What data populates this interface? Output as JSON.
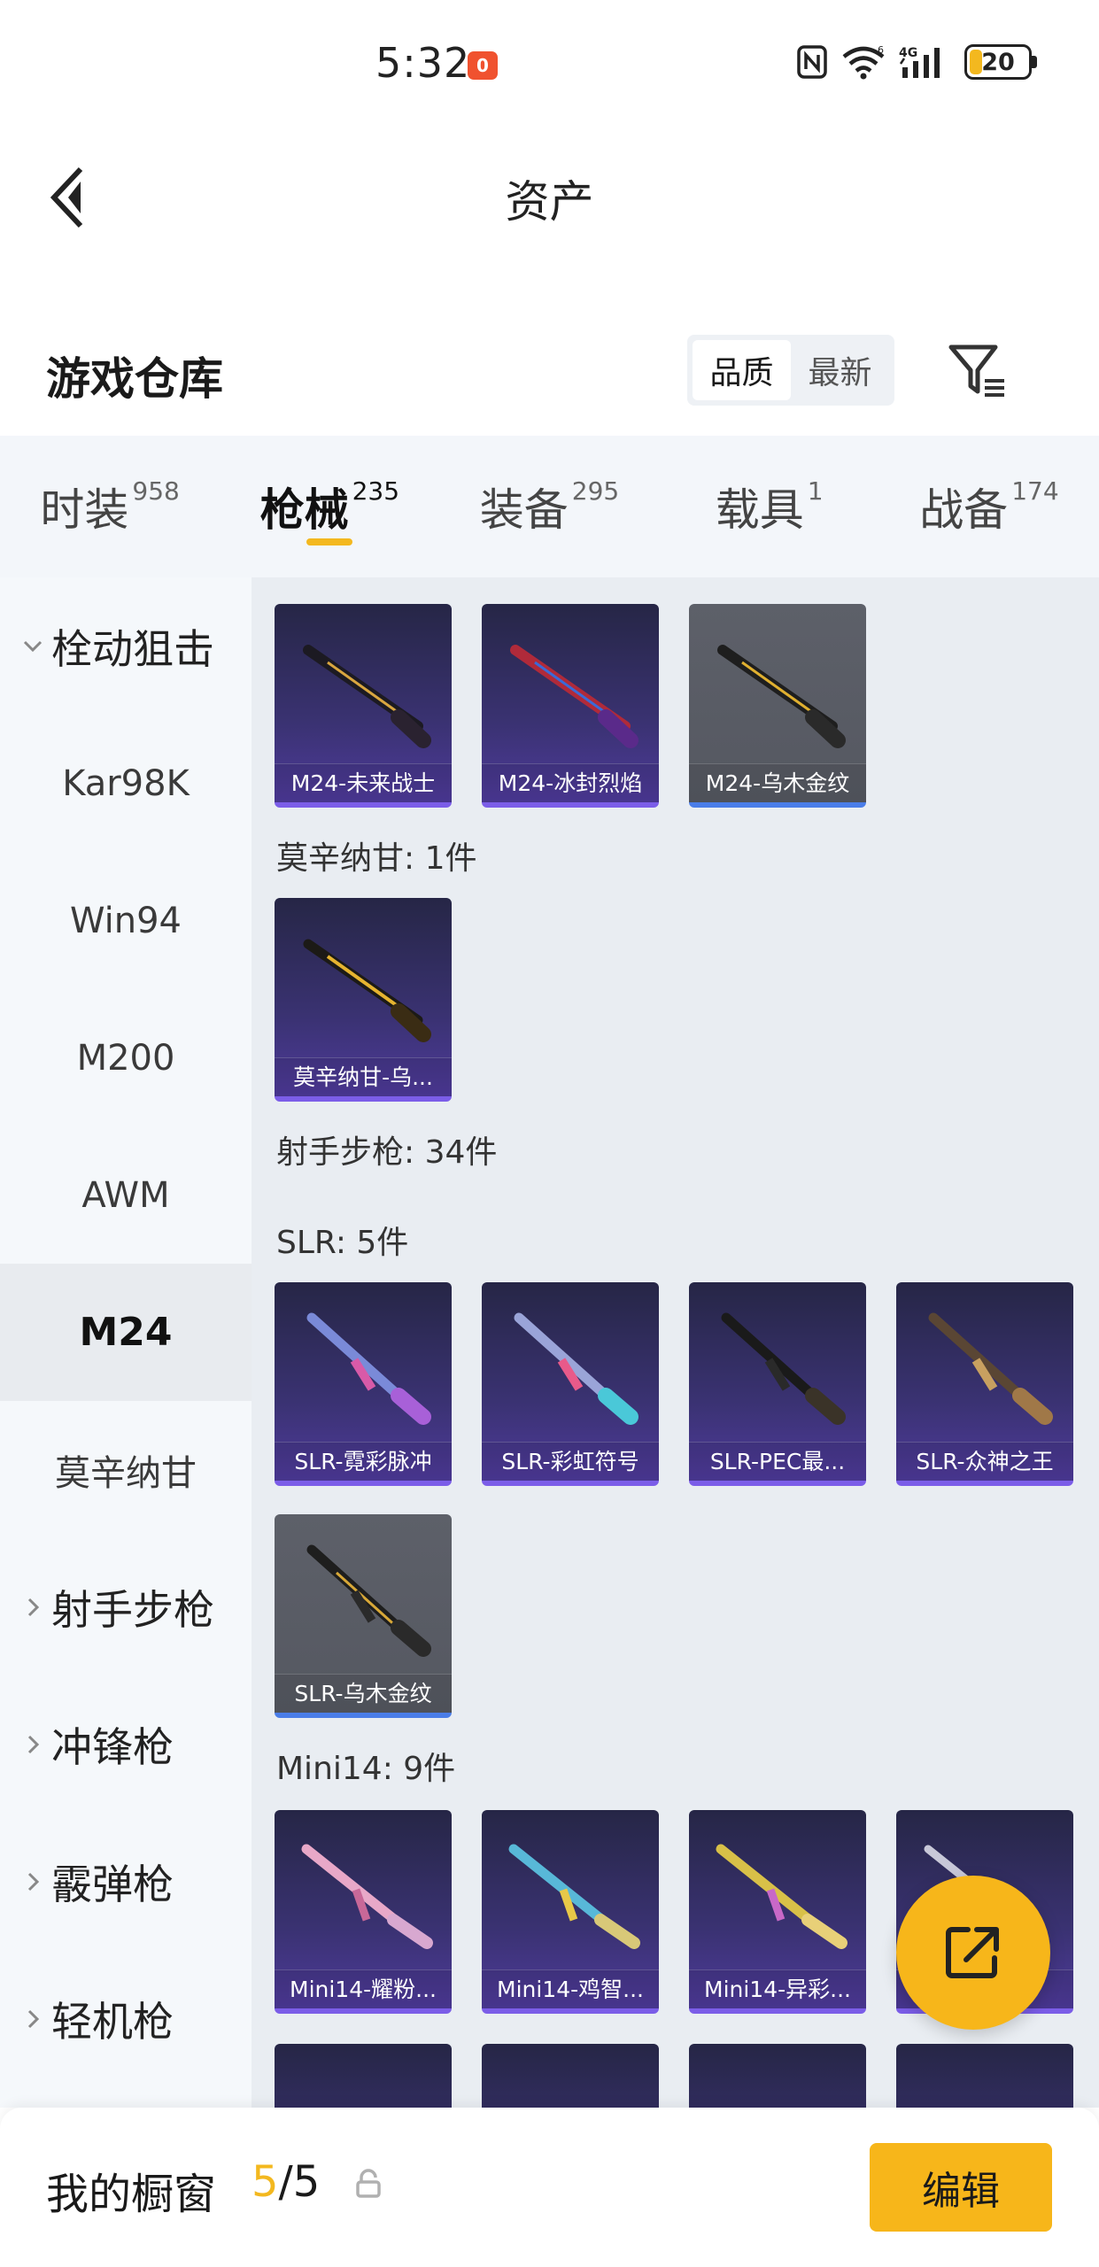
{
  "status": {
    "time": "5:32",
    "notif_badge": "0",
    "network": "4G",
    "battery": "20"
  },
  "header": {
    "title": "资产"
  },
  "section": {
    "title": "游戏仓库",
    "sort_options": [
      "品质",
      "最新"
    ],
    "sort_active": "品质"
  },
  "tabs": [
    {
      "label": "时装",
      "count": "958"
    },
    {
      "label": "枪械",
      "count": "235",
      "active": true
    },
    {
      "label": "装备",
      "count": "295"
    },
    {
      "label": "载具",
      "count": "1"
    },
    {
      "label": "战备",
      "count": "174"
    }
  ],
  "sidebar": {
    "group_bolt": "栓动狙击",
    "items": [
      "Kar98K",
      "Win94",
      "M200",
      "AWM",
      "M24",
      "莫辛纳甘"
    ],
    "selected": "M24",
    "groups": [
      "射手步枪",
      "冲锋枪",
      "霰弹枪",
      "轻机枪"
    ]
  },
  "content": {
    "row1": [
      {
        "name": "M24-未来战士",
        "rarity": "purple"
      },
      {
        "name": "M24-冰封烈焰",
        "rarity": "purple"
      },
      {
        "name": "M24-乌木金纹",
        "rarity": "gray"
      }
    ],
    "mosin_label": "莫辛纳甘: 1件",
    "mosin_cards": [
      {
        "name": "莫辛纳甘-乌...",
        "rarity": "purple"
      }
    ],
    "marksman_label": "射手步枪: 34件",
    "slr_label": "SLR: 5件",
    "slr_cards": [
      {
        "name": "SLR-霓彩脉冲",
        "rarity": "purple"
      },
      {
        "name": "SLR-彩虹符号",
        "rarity": "purple"
      },
      {
        "name": "SLR-PEC最...",
        "rarity": "purple"
      },
      {
        "name": "SLR-众神之王",
        "rarity": "purple"
      },
      {
        "name": "SLR-乌木金纹",
        "rarity": "gray"
      }
    ],
    "mini14_label": "Mini14: 9件",
    "mini14_cards": [
      {
        "name": "Mini14-耀粉...",
        "rarity": "purple"
      },
      {
        "name": "Mini14-鸡智...",
        "rarity": "purple"
      },
      {
        "name": "Mini14-异彩...",
        "rarity": "purple"
      },
      {
        "name": "...",
        "rarity": "purple"
      }
    ]
  },
  "bottom": {
    "label": "我的橱窗",
    "count_current": "5",
    "count_sep": "/5",
    "edit_label": "编辑"
  },
  "colors": {
    "accent": "#f3b81f",
    "purple_card": "#3a3272",
    "gray_card": "#5d6069"
  }
}
